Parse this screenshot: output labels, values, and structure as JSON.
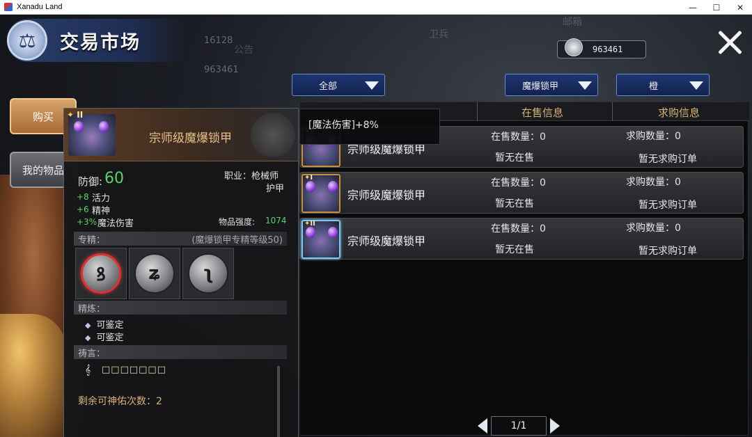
{
  "window": {
    "title": "Xanadu Land",
    "minimize": "—",
    "maximize": "☐",
    "close": "✕"
  },
  "header": {
    "title": "交易市场",
    "emblem_icon": "scales-icon"
  },
  "background": {
    "num_1": "16128",
    "num_2": "963461",
    "label_guard": "卫兵",
    "label_mail": "邮箱",
    "label_ad": "公告"
  },
  "currency": {
    "value": "963461",
    "icon": "silver-coin-icon"
  },
  "tabs": {
    "buy": "购买",
    "mine": "我的物品"
  },
  "filters": {
    "category": "全部",
    "type": "魔爆锁甲",
    "quality": "橙"
  },
  "list": {
    "headers": [
      "在售信息",
      "求购信息"
    ],
    "rows": [
      {
        "tier": "I",
        "name": "宗师级魔爆锁甲",
        "sell_count": "在售数量：0",
        "sell_status": "暂无在售",
        "buy_count": "求购数量：0",
        "buy_status": "暂无求购订单",
        "selected": false
      },
      {
        "tier": "I",
        "name": "宗师级魔爆锁甲",
        "sell_count": "在售数量：0",
        "sell_status": "暂无在售",
        "buy_count": "求购数量：0",
        "buy_status": "暂无求购订单",
        "selected": false
      },
      {
        "tier": "II",
        "name": "宗师级魔爆锁甲",
        "sell_count": "在售数量：0",
        "sell_status": "暂无在售",
        "buy_count": "求购数量：0",
        "buy_status": "暂无求购订单",
        "selected": true
      }
    ]
  },
  "pager": {
    "page": "1/1"
  },
  "hover_tip": {
    "text": "[魔法伤害]+8%"
  },
  "card": {
    "tier": "II",
    "title": "宗师级魔爆锁甲",
    "defense_label": "防御:",
    "defense_value": "60",
    "job_label": "职业：枪械师",
    "armor_type": "护甲",
    "stats": [
      {
        "value": "+8",
        "name": "活力"
      },
      {
        "value": "+6",
        "name": "精神"
      },
      {
        "value": "+3%",
        "name": "魔法伤害"
      }
    ],
    "strength_label": "物品强度:",
    "strength_value": "1074",
    "spec_label": "专精：",
    "spec_note": "(魔爆锁甲专精等级50)",
    "refine_label": "精炼：",
    "refine_items": [
      "可鉴定",
      "可鉴定"
    ],
    "prayer_label": "祷言：",
    "prayer_slots": "□□□□□□□",
    "blessings_left": "剩余可神佑次数：2"
  },
  "colors": {
    "accent_gold": "#d8b07a",
    "green_stat": "#5fd06a",
    "dropdown_blue": "#1e3570"
  }
}
